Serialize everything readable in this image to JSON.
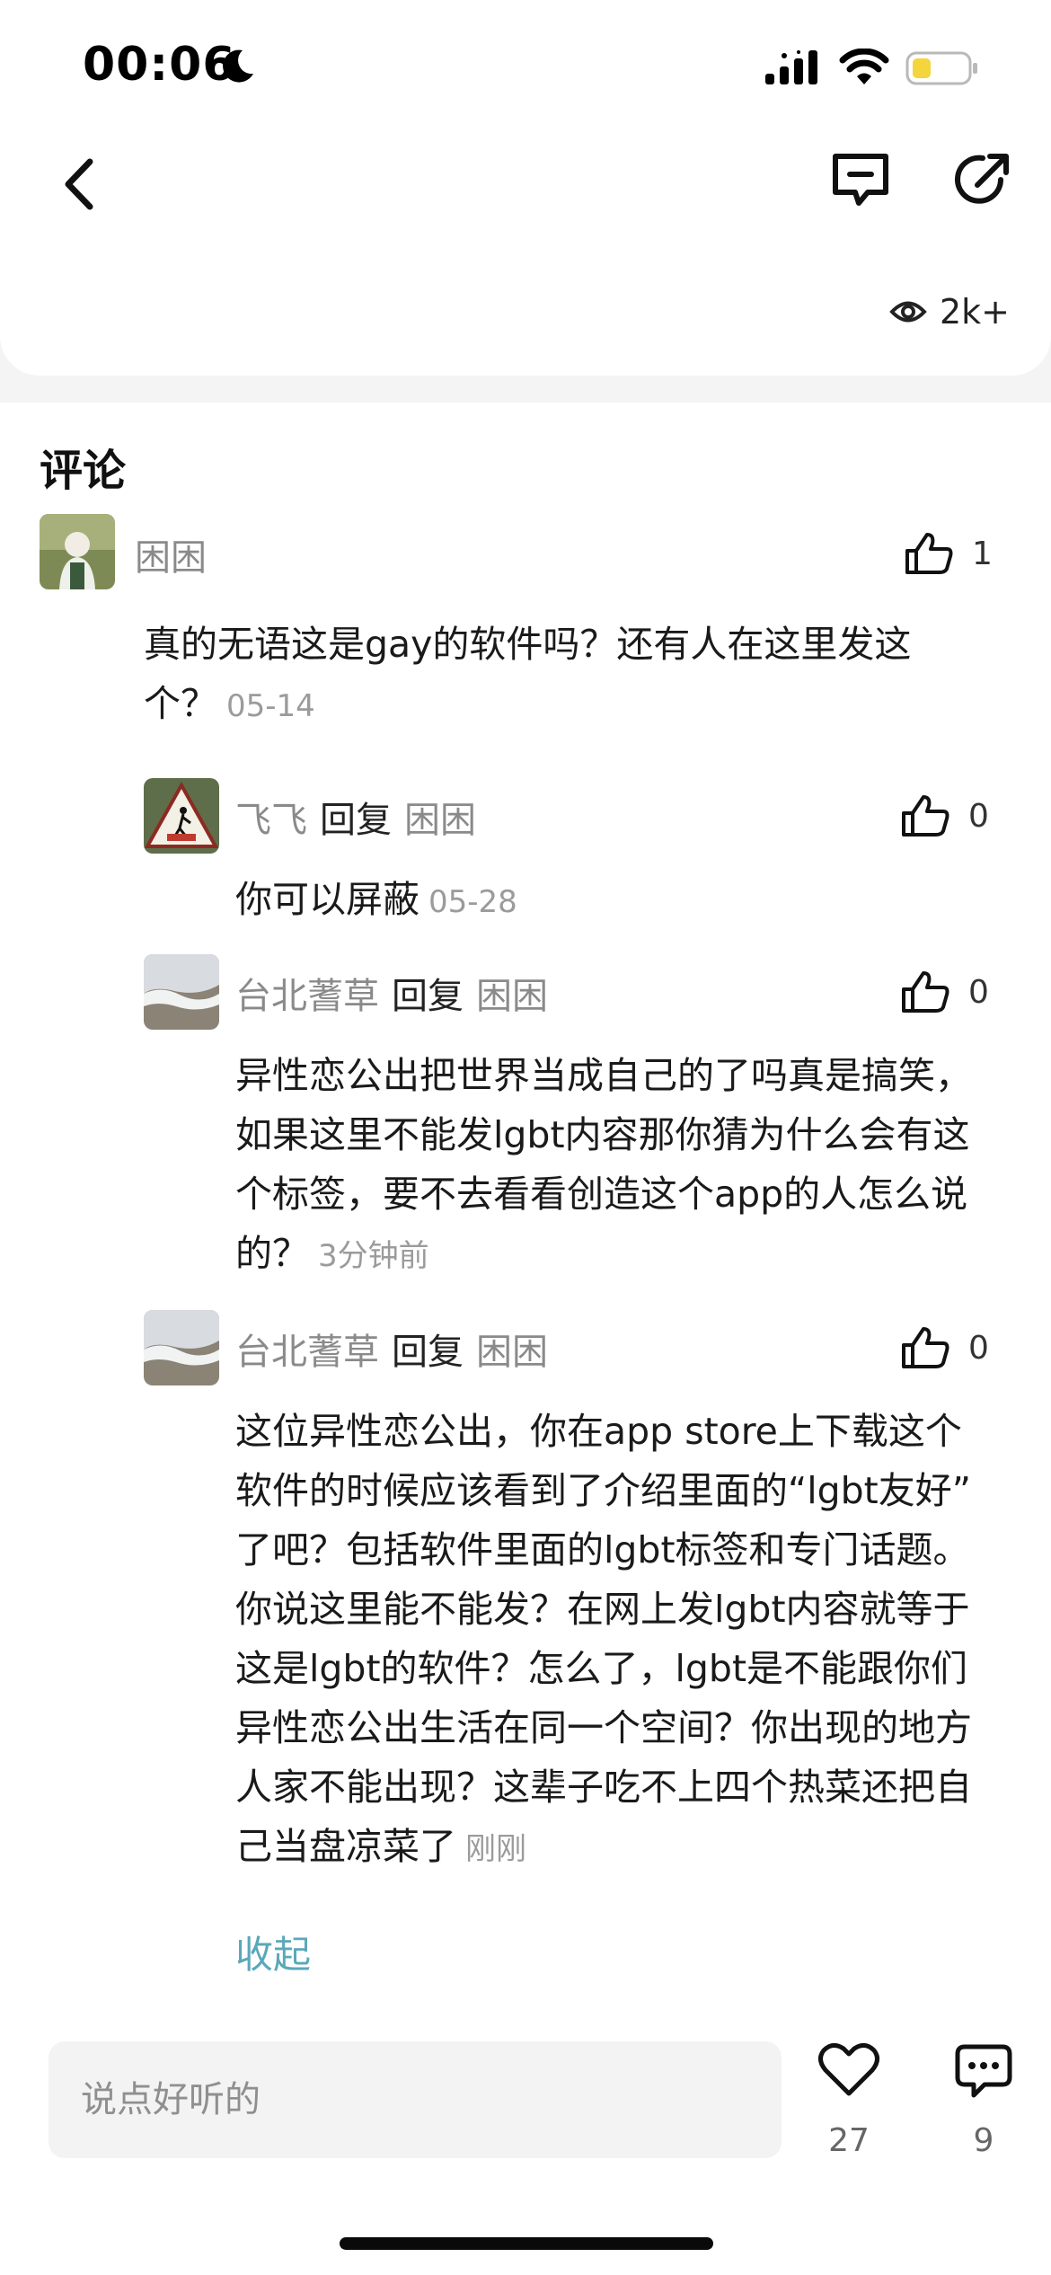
{
  "status_bar": {
    "time": "00:06"
  },
  "header": {
    "views": "2k+"
  },
  "comments": {
    "title": "评论",
    "main": {
      "author": "困困",
      "likes": "1",
      "line1": "真的无语这是gay的软件吗？还有人在这里发这",
      "line2": "个？",
      "time": "05-14"
    },
    "replies": [
      {
        "author": "飞飞",
        "reply_label": "回复",
        "reply_to": "困困",
        "likes": "0",
        "lines": [
          "你可以屏蔽"
        ],
        "time": "05-28"
      },
      {
        "author": "台北蓍草",
        "reply_label": "回复",
        "reply_to": "困困",
        "likes": "0",
        "lines": [
          "异性恋公出把世界当成自己的了吗真是搞笑，",
          "如果这里不能发lgbt内容那你猜为什么会有这",
          "个标签，要不去看看创造这个app的人怎么说",
          "的？"
        ],
        "time": "3分钟前"
      },
      {
        "author": "台北蓍草",
        "reply_label": "回复",
        "reply_to": "困困",
        "likes": "0",
        "lines": [
          "这位异性恋公出，你在app store上下载这个",
          "软件的时候应该看到了介绍里面的“lgbt友好”",
          "了吧？包括软件里面的lgbt标签和专门话题。",
          "你说这里能不能发？在网上发lgbt内容就等于",
          "这是lgbt的软件？怎么了，lgbt是不能跟你们",
          "异性恋公出生活在同一个空间？你出现的地方",
          "人家不能出现？这辈子吃不上四个热菜还把自",
          "己当盘凉菜了"
        ],
        "time": "刚刚"
      }
    ],
    "collapse": "收起"
  },
  "bottom_bar": {
    "input_placeholder": "说点好听的",
    "like_count": "27",
    "comment_count": "9"
  },
  "colors": {
    "accent": "#5aa8b8",
    "battery": "#f5d53c"
  }
}
